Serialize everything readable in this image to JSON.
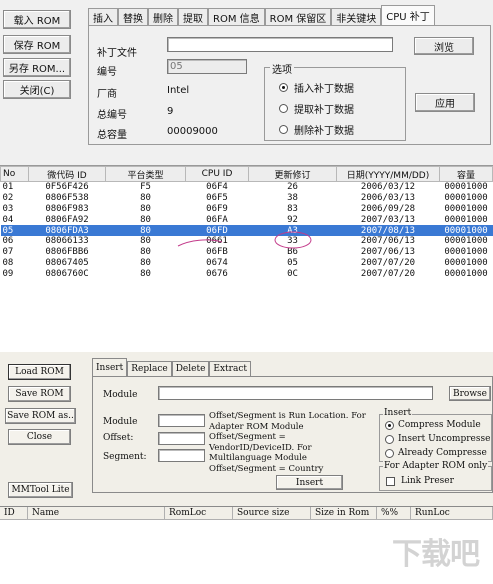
{
  "top": {
    "sidebar": {
      "load_rom": "载入 ROM",
      "save_rom": "保存 ROM",
      "save_as": "另存 ROM...",
      "close": "关闭(C)"
    },
    "tabs": [
      "插入",
      "替换",
      "删除",
      "提取",
      "ROM 信息",
      "ROM 保留区",
      "非关键块",
      "CPU 补丁"
    ],
    "active_tab": 7,
    "form": {
      "patch_file_label": "补丁文件",
      "patch_file_value": "",
      "browse_button": "浏览",
      "id_label": "编号",
      "id_value": "05",
      "vendor_label": "厂商",
      "vendor_value": "Intel",
      "total_id_label": "总编号",
      "total_id_value": "9",
      "total_size_label": "总容量",
      "total_size_value": "00009000",
      "apply_button": "应用"
    },
    "options": {
      "legend": "选项",
      "items": [
        {
          "label": "插入补丁数据",
          "checked": true
        },
        {
          "label": "提取补丁数据",
          "checked": false
        },
        {
          "label": "删除补丁数据",
          "checked": false
        }
      ]
    },
    "table": {
      "headers": [
        "No",
        "微代码 ID",
        "平台类型",
        "CPU ID",
        "更新修订",
        "日期(YYYY/MM/DD)",
        "容量"
      ],
      "rows": [
        [
          "01",
          "0F56F426",
          "F5",
          "06F4",
          "26",
          "2006/03/12",
          "00001000"
        ],
        [
          "02",
          "0806F538",
          "80",
          "06F5",
          "38",
          "2006/03/13",
          "00001000"
        ],
        [
          "03",
          "0806F983",
          "80",
          "06F9",
          "83",
          "2006/09/28",
          "00001000"
        ],
        [
          "04",
          "0806FA92",
          "80",
          "06FA",
          "92",
          "2007/03/13",
          "00001000"
        ],
        [
          "05",
          "0806FDA3",
          "80",
          "06FD",
          "A3",
          "2007/08/13",
          "00001000"
        ],
        [
          "06",
          "08066133",
          "80",
          "0661",
          "33",
          "2007/06/13",
          "00001000"
        ],
        [
          "07",
          "0806FBB6",
          "80",
          "06FB",
          "B6",
          "2007/06/13",
          "00001000"
        ],
        [
          "08",
          "08067405",
          "80",
          "0674",
          "05",
          "2007/07/20",
          "00001000"
        ],
        [
          "09",
          "0806760C",
          "80",
          "0676",
          "0C",
          "2007/07/20",
          "00001000"
        ]
      ],
      "selected_row": 4
    }
  },
  "bottom": {
    "buttons": {
      "load_rom": "Load ROM",
      "save_rom": "Save ROM",
      "save_rom_as": "Save ROM as..",
      "close": "Close",
      "mmtool_lite": "MMTool Lite"
    },
    "tabs": [
      "Insert",
      "Replace",
      "Delete",
      "Extract"
    ],
    "active_tab": 0,
    "form": {
      "module_label": "Module",
      "module_value": "",
      "browse_button": "Browse",
      "module2_label": "Module",
      "offset_label": "Offset:",
      "segment_label": "Segment:",
      "help_text": "Offset/Segment is Run Location. For Adapter ROM Module Offset/Segment = VendorID/DeviceID. For Multilanguage Module Offset/Segment = Country",
      "insert_button": "Insert"
    },
    "insert_group": {
      "legend": "Insert",
      "options": [
        {
          "label": "Compress Module",
          "checked": true
        },
        {
          "label": "Insert Uncompresse",
          "checked": false
        },
        {
          "label": "Already Compresse",
          "checked": false
        }
      ]
    },
    "adapter_group": {
      "legend": "For Adapter ROM only",
      "link_label": "Link Preser",
      "checked": false
    },
    "table_headers": [
      "ID",
      "Name",
      "RomLoc",
      "Source size",
      "Size in Rom",
      "%%",
      "RunLoc"
    ]
  },
  "watermark": "下载吧"
}
